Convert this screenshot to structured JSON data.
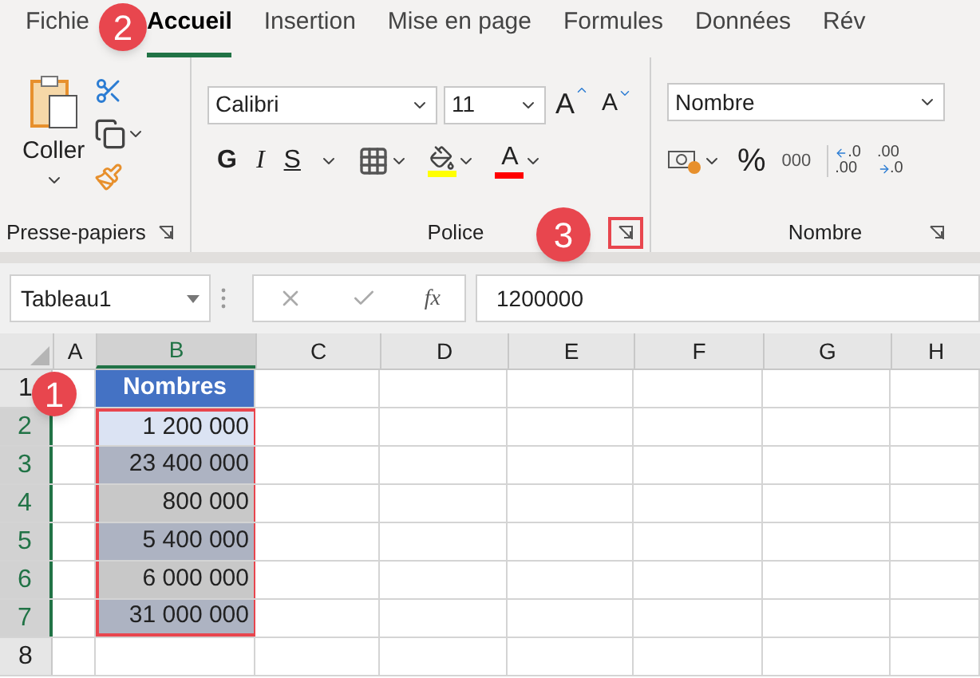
{
  "tabs": [
    {
      "label": "Fichie",
      "selected": false
    },
    {
      "label": "Accueil",
      "selected": true
    },
    {
      "label": "Insertion",
      "selected": false
    },
    {
      "label": "Mise en page",
      "selected": false
    },
    {
      "label": "Formules",
      "selected": false
    },
    {
      "label": "Données",
      "selected": false
    },
    {
      "label": "Rév",
      "selected": false
    }
  ],
  "ribbon": {
    "clipboard": {
      "paste_label": "Coller",
      "group_label": "Presse-papiers"
    },
    "font": {
      "font_name": "Calibri",
      "font_size": "11",
      "grow_label": "A",
      "shrink_label": "A",
      "bold_label": "G",
      "italic_label": "I",
      "underline_label": "S",
      "font_color_label": "A",
      "group_label": "Police",
      "launcher_highlighted": true
    },
    "number": {
      "format": "Nombre",
      "percent_label": "%",
      "thousands_label": "000",
      "increase_decimal": [
        ".0",
        ".00"
      ],
      "decrease_decimal": [
        ".00",
        ".0"
      ],
      "group_label": "Nombre"
    }
  },
  "formula_bar": {
    "name_box": "Tableau1",
    "function_label": "fx",
    "value": "1200000"
  },
  "sheet": {
    "columns": [
      {
        "label": "A",
        "selected": false
      },
      {
        "label": "B",
        "selected": true
      },
      {
        "label": "C",
        "selected": false
      },
      {
        "label": "D",
        "selected": false
      },
      {
        "label": "E",
        "selected": false
      },
      {
        "label": "F",
        "selected": false
      },
      {
        "label": "G",
        "selected": false
      },
      {
        "label": "H",
        "selected": false
      }
    ],
    "rows": [
      {
        "number": "1",
        "selected": false,
        "b": "Nombres",
        "kind": "header"
      },
      {
        "number": "2",
        "selected": true,
        "b": "1 200 000",
        "kind": "active"
      },
      {
        "number": "3",
        "selected": true,
        "b": "23 400 000",
        "kind": "data"
      },
      {
        "number": "4",
        "selected": true,
        "b": "800 000",
        "kind": "data"
      },
      {
        "number": "5",
        "selected": true,
        "b": "5 400 000",
        "kind": "data"
      },
      {
        "number": "6",
        "selected": true,
        "b": "6 000 000",
        "kind": "data"
      },
      {
        "number": "7",
        "selected": true,
        "b": "31 000 000",
        "kind": "data"
      },
      {
        "number": "8",
        "selected": false,
        "b": "",
        "kind": "empty"
      }
    ]
  },
  "annotations": [
    {
      "label": "2"
    },
    {
      "label": "3"
    },
    {
      "label": "1"
    }
  ]
}
